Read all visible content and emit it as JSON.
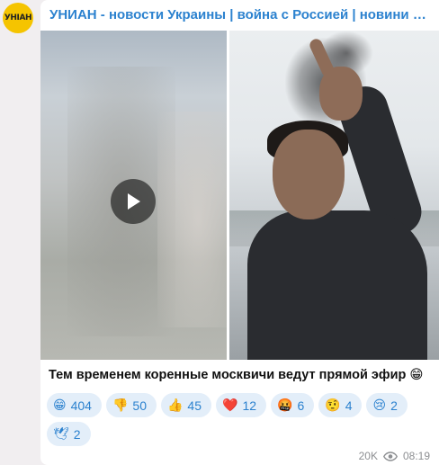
{
  "channel": {
    "avatar_text": "УНIAН",
    "title": "УНИАН - новости Украины | война с Россией | новини України..."
  },
  "post": {
    "caption": "Тем временем коренные москвичи ведут прямой эфир 😁",
    "reactions": [
      {
        "emoji": "😁",
        "count": "404"
      },
      {
        "emoji": "👎",
        "count": "50"
      },
      {
        "emoji": "👍",
        "count": "45"
      },
      {
        "emoji": "❤️",
        "count": "12"
      },
      {
        "emoji": "🤬",
        "count": "6"
      },
      {
        "emoji": "🤨",
        "count": "4"
      },
      {
        "emoji": "😢",
        "count": "2"
      },
      {
        "emoji": "🕊",
        "count": "2"
      }
    ],
    "views": "20K",
    "time": "08:19"
  },
  "icons": {
    "play": "play-icon",
    "views": "eye-icon"
  },
  "colors": {
    "accent": "#2c82cf",
    "reaction_bg": "#e3eef9",
    "avatar": "#f5c400"
  }
}
